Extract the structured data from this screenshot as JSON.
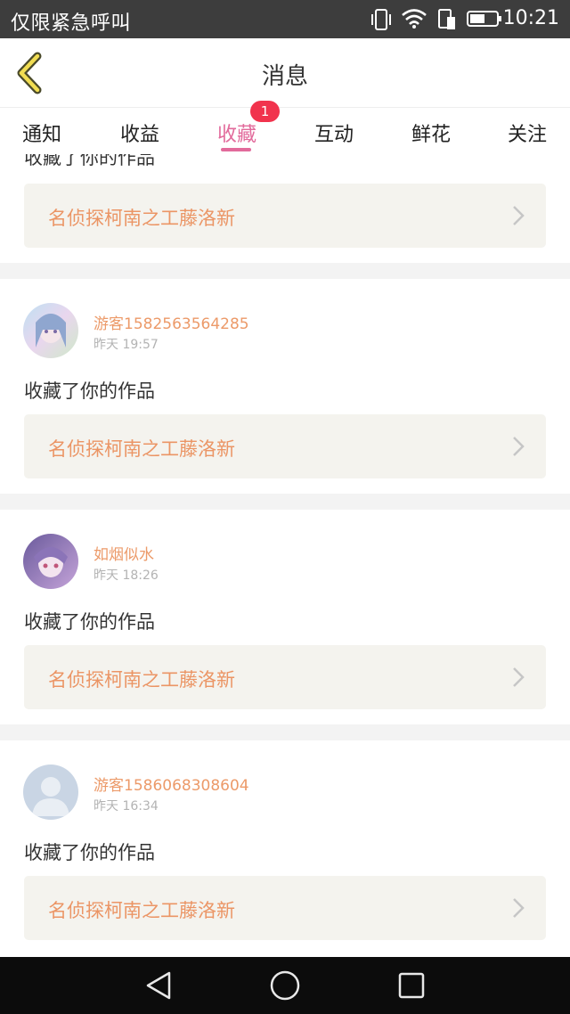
{
  "status_bar": {
    "carrier": "仅限紧急呼叫",
    "time": "10:21"
  },
  "header": {
    "title": "消息"
  },
  "tabs": [
    {
      "label": "通知"
    },
    {
      "label": "收益"
    },
    {
      "label": "收藏",
      "badge": "1",
      "active": true
    },
    {
      "label": "互动"
    },
    {
      "label": "鲜花"
    },
    {
      "label": "关注"
    }
  ],
  "feed": {
    "partial_item": {
      "action": "收藏了你的作品",
      "work_title": "名侦探柯南之工藤洛新"
    },
    "items": [
      {
        "user": "游客1582563564285",
        "time": "昨天 19:57",
        "action": "收藏了你的作品",
        "work_title": "名侦探柯南之工藤洛新",
        "avatar": "anime-avatar-pastel"
      },
      {
        "user": "如烟似水",
        "time": "昨天 18:26",
        "action": "收藏了你的作品",
        "work_title": "名侦探柯南之工藤洛新",
        "avatar": "anime-avatar-purple"
      },
      {
        "user": "游客1586068308604",
        "time": "昨天 16:34",
        "action": "收藏了你的作品",
        "work_title": "名侦探柯南之工藤洛新",
        "avatar": "default-user-avatar"
      }
    ]
  },
  "colors": {
    "accent": "#e26a9b",
    "username": "#ec9a69",
    "badge": "#f1334d"
  }
}
